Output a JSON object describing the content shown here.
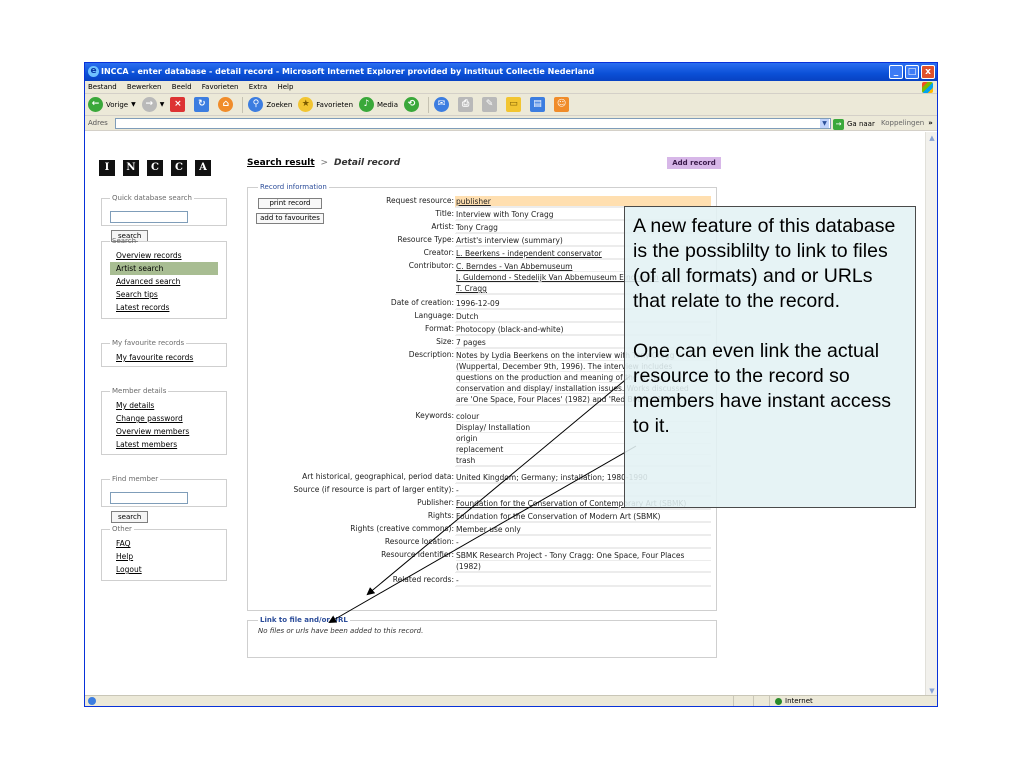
{
  "window": {
    "title": "INCCA - enter database - detail record - Microsoft Internet Explorer provided by Instituut Collectie Nederland",
    "controls": [
      "_",
      "□",
      "x"
    ]
  },
  "menubar": [
    "Bestand",
    "Bewerken",
    "Beeld",
    "Favorieten",
    "Extra",
    "Help"
  ],
  "toolbar": {
    "back": "Vorige",
    "search": "Zoeken",
    "favorites": "Favorieten",
    "media": "Media"
  },
  "address": {
    "label": "Adres",
    "value": "",
    "go": "Ga naar",
    "links": "Koppelingen",
    "links_more": "»"
  },
  "logo": [
    "I",
    "N",
    "C",
    "C",
    "A"
  ],
  "breadcrumb": {
    "link": "Search result",
    "sep": ">",
    "current": "Detail record"
  },
  "add_record": "Add record",
  "sidebar": {
    "quick_search": {
      "legend": "Quick database search",
      "button": "search"
    },
    "search": {
      "legend": "Search",
      "items": [
        {
          "label": "Overview records",
          "active": false
        },
        {
          "label": "Artist search",
          "active": true
        },
        {
          "label": "Advanced search",
          "active": false
        },
        {
          "label": "Search tips",
          "active": false
        },
        {
          "label": "Latest records",
          "active": false
        }
      ]
    },
    "favourites": {
      "legend": "My favourite records",
      "items": [
        "My favourite records"
      ]
    },
    "member": {
      "legend": "Member details",
      "items": [
        "My details",
        "Change password",
        "Overview members",
        "Latest members"
      ]
    },
    "find_member": {
      "legend": "Find member",
      "button": "search"
    },
    "other": {
      "legend": "Other",
      "items": [
        "FAQ",
        "Help",
        "Logout"
      ]
    }
  },
  "record": {
    "legend": "Record information",
    "print_button": "print record",
    "favourites_button": "add to favourites",
    "fields": [
      {
        "label": "Request resource:",
        "lines": [
          "publisher"
        ]
      },
      {
        "label": "Title:",
        "lines": [
          "Interview with Tony Cragg"
        ]
      },
      {
        "label": "Artist:",
        "lines": [
          "Tony Cragg"
        ]
      },
      {
        "label": "Resource Type:",
        "lines": [
          "Artist's interview (summary)"
        ]
      },
      {
        "label": "Creator:",
        "lines": [
          "L. Beerkens - independent conservator"
        ]
      },
      {
        "label": "Contributor:",
        "lines": [
          "C. Berndes - Van Abbemuseum",
          "J. Guldemond - Stedelijk Van Abbemuseum Eindhoven",
          "T. Cragg"
        ]
      },
      {
        "label": "Date of creation:",
        "lines": [
          "1996-12-09"
        ]
      },
      {
        "label": "Language:",
        "lines": [
          "Dutch"
        ]
      },
      {
        "label": "Format:",
        "lines": [
          "Photocopy (black-and-white)"
        ]
      },
      {
        "label": "Size:",
        "lines": [
          "7 pages"
        ]
      },
      {
        "label": "Description:",
        "lines": [
          "Notes by Lydia Beerkens on the interview with Tony Cragg",
          "(Wuppertal, December 9th, 1996). The interview includes",
          "questions on the production and meaning of the works,",
          "conservation and display/ installation issues. Works discussed",
          "are 'One Space, Four Places' (1982) and 'Red Bottle' (1982)."
        ]
      },
      {
        "label": "Keywords:",
        "lines": [
          "colour",
          "Display/ Installation",
          "origin",
          "replacement",
          "trash"
        ]
      },
      {
        "label": "Art historical, geographical, period data:",
        "lines": [
          "United Kingdom; Germany; installation; 1980-1990"
        ]
      },
      {
        "label": "Source (if resource is part of larger entity):",
        "lines": [
          "-"
        ]
      },
      {
        "label": "Publisher:",
        "lines": [
          "Foundation for the Conservation of Contemporary Art (SBMK)"
        ]
      },
      {
        "label": "Rights:",
        "lines": [
          "Foundation for the Conservation of Modern Art (SBMK)"
        ]
      },
      {
        "label": "Rights (creative commons):",
        "lines": [
          "Member use only"
        ]
      },
      {
        "label": "Resource location:",
        "lines": [
          "-"
        ]
      },
      {
        "label": "Resource identifier:",
        "lines": [
          "SBMK Research Project - Tony Cragg: One Space, Four Places",
          "(1982)"
        ]
      },
      {
        "label": "Related records:",
        "lines": [
          "-"
        ]
      }
    ]
  },
  "link_box": {
    "legend": "Link to file and/or URL",
    "message": "No files or urls have been added to this record."
  },
  "status": {
    "zone": "Internet"
  },
  "callout": {
    "para1": "A new feature of this database is the possiblilty to link to files (of all formats) and or URLs that relate to the record.",
    "para2": "One can even link the actual resource to the record so members have instant access to it."
  }
}
